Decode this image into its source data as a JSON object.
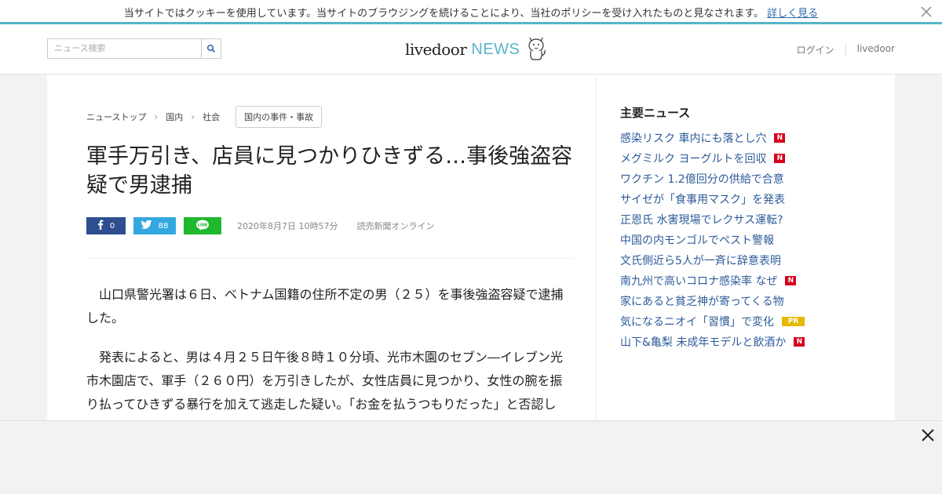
{
  "cookie": {
    "text": "当サイトではクッキーを使用しています。当サイトのブラウジングを続けることにより、当社のポリシーを受け入れたものと見なされます。",
    "link": "詳しく見る",
    "close_icon": "close-icon"
  },
  "header": {
    "search_placeholder": "ニュース検索",
    "search_icon": "search-icon",
    "logo_livedoor": "livedoor",
    "logo_news": "NEWS",
    "nav_login": "ログイン",
    "nav_livedoor": "livedoor"
  },
  "breadcrumb": {
    "items": [
      "ニューストップ",
      "国内",
      "社会"
    ],
    "tag": "国内の事件・事故"
  },
  "article": {
    "title": "軍手万引き、店員に見つかりひきずる…事後強盗容疑で男逮捕",
    "share": {
      "facebook_count": "0",
      "twitter_count": "88"
    },
    "date": "2020年8月7日 10時57分",
    "source": "読売新聞オンライン",
    "paragraphs": [
      "山口県警光署は６日、ベトナム国籍の住所不定の男（２５）を事後強盗容疑で逮捕した。",
      "発表によると、男は４月２５日午後８時１０分頃、光市木園のセブン―イレブン光市木園店で、軍手（２６０円）を万引きしたが、女性店員に見つかり、女性の腕を振り払ってひきずる暴行を加えて逃走した疑い。「お金を払うつもりだった」と否認し"
    ]
  },
  "sidebar": {
    "title": "主要ニュース",
    "items": [
      {
        "label": "感染リスク 車内にも落とし穴",
        "badge": "N"
      },
      {
        "label": "メグミルク ヨーグルトを回収",
        "badge": "N"
      },
      {
        "label": "ワクチン 1.2億回分の供給で合意",
        "badge": ""
      },
      {
        "label": "サイゼが「食事用マスク」を発表",
        "badge": ""
      },
      {
        "label": "正恩氏 水害現場でレクサス運転?",
        "badge": ""
      },
      {
        "label": "中国の内モンゴルでペスト警報",
        "badge": ""
      },
      {
        "label": "文氏側近ら5人が一斉に辞意表明",
        "badge": ""
      },
      {
        "label": "南九州で高いコロナ感染率 なぜ",
        "badge": "N"
      },
      {
        "label": "家にあると貧乏神が寄ってくる物",
        "badge": ""
      },
      {
        "label": "気になるニオイ「習慣」で変化",
        "badge": "PR"
      },
      {
        "label": "山下&亀梨 未成年モデルと飲酒か",
        "badge": "N"
      }
    ]
  },
  "colors": {
    "accent": "#5ab4c9",
    "link": "#2e5b9a",
    "badge_new": "#d6001c",
    "badge_pr": "#e6b800",
    "facebook": "#2d4f8f",
    "twitter": "#33a8e0",
    "line": "#1fb82e"
  }
}
